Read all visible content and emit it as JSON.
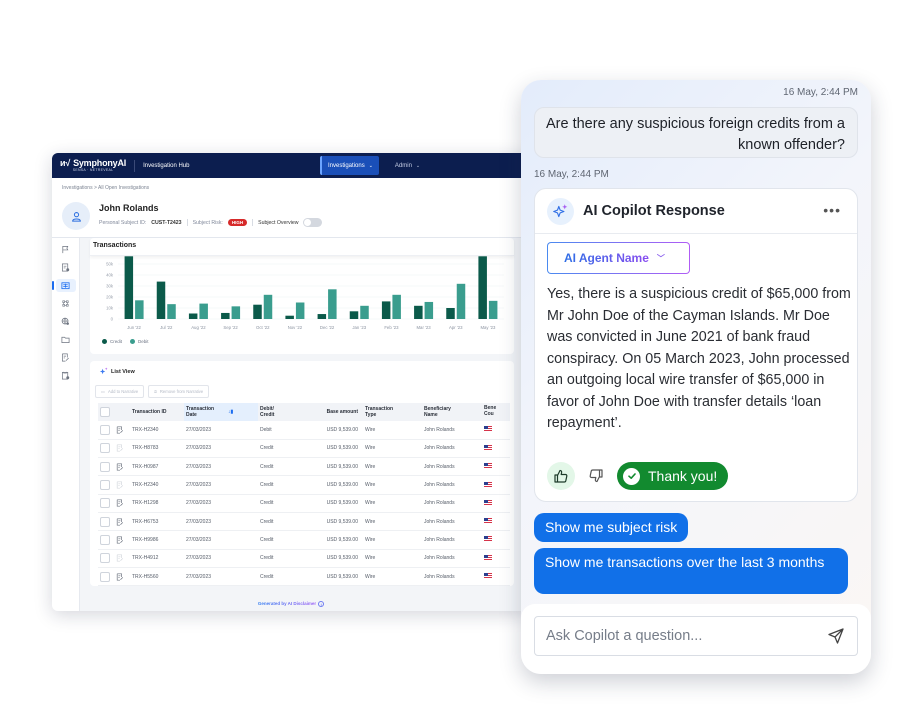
{
  "app": {
    "logo": "SymphonyAI",
    "logo_sub": "SENSA · NETREVEAL",
    "app_name": "Investigation Hub",
    "nav": [
      {
        "label": "Investigations",
        "active": true
      },
      {
        "label": "Admin",
        "active": false
      }
    ],
    "breadcrumb": "Investigations > All Open Investigations",
    "subject": {
      "name": "John Rolands",
      "id_label": "Personal Subject ID:",
      "id_value": "CUST-T2423",
      "risk_label": "Subject Risk:",
      "risk_value": "HIGH",
      "overview_label": "Subject Overview",
      "overview_on": false
    },
    "sidebar_icons": [
      "flag-icon",
      "report-icon",
      "transactions-icon",
      "network-icon",
      "globe-search-icon",
      "folder-icon",
      "notes-icon",
      "clipboard-icon"
    ],
    "sidebar_active_index": 2,
    "transactions_title": "Transactions",
    "list_view": {
      "title": "List View",
      "add_button": "Add to Narrative",
      "remove_button": "Remove from Narrative",
      "columns": [
        "Transaction ID",
        "Transaction Date",
        "Debit/ Credit",
        "Base amount",
        "Transaction Type",
        "Beneficiary Name",
        "Bene Cou"
      ],
      "rows": [
        {
          "id": "TRX-H2340",
          "date": "27/03/2023",
          "dc": "Debit",
          "amount": "USD 9,539.00",
          "type": "Wire",
          "beneficiary": "John Rolands",
          "country": "US",
          "note": true
        },
        {
          "id": "TRX-H8783",
          "date": "27/03/2023",
          "dc": "Credit",
          "amount": "USD 9,539.00",
          "type": "Wire",
          "beneficiary": "John Rolands",
          "country": "US",
          "note": false
        },
        {
          "id": "TRX-H0987",
          "date": "27/03/2023",
          "dc": "Credit",
          "amount": "USD 9,539.00",
          "type": "Wire",
          "beneficiary": "John Rolands",
          "country": "US",
          "note": true
        },
        {
          "id": "TRX-H2340",
          "date": "27/03/2023",
          "dc": "Credit",
          "amount": "USD 9,539.00",
          "type": "Wire",
          "beneficiary": "John Rolands",
          "country": "US",
          "note": false
        },
        {
          "id": "TRX-H1298",
          "date": "27/03/2023",
          "dc": "Credit",
          "amount": "USD 9,539.00",
          "type": "Wire",
          "beneficiary": "John Rolands",
          "country": "US",
          "note": true
        },
        {
          "id": "TRX-H6753",
          "date": "27/03/2023",
          "dc": "Credit",
          "amount": "USD 9,539.00",
          "type": "Wire",
          "beneficiary": "John Rolands",
          "country": "US",
          "note": true
        },
        {
          "id": "TRX-H9986",
          "date": "27/03/2023",
          "dc": "Credit",
          "amount": "USD 9,539.00",
          "type": "Wire",
          "beneficiary": "John Rolands",
          "country": "US",
          "note": true
        },
        {
          "id": "TRX-H4912",
          "date": "27/03/2023",
          "dc": "Credit",
          "amount": "USD 9,539.00",
          "type": "Wire",
          "beneficiary": "John Rolands",
          "country": "US",
          "note": false
        },
        {
          "id": "TRX-H5560",
          "date": "27/03/2023",
          "dc": "Credit",
          "amount": "USD 9,539.00",
          "type": "Wire",
          "beneficiary": "John Rolands",
          "country": "US",
          "note": true
        }
      ]
    },
    "disclaimer": "Generated by AI Disclaimer"
  },
  "chart_data": {
    "type": "bar",
    "title": "Transactions",
    "categories": [
      "Jun '22",
      "Jul '22",
      "Aug '22",
      "Sep '22",
      "Oct '22",
      "Nov '22",
      "Dec '22",
      "Jan '23",
      "Feb '23",
      "Mar '23",
      "Apr '23",
      "May '23"
    ],
    "series": [
      {
        "name": "Credit",
        "color": "#0b5a4a",
        "values": [
          57000,
          34000,
          5000,
          5500,
          13000,
          3000,
          4500,
          7000,
          16000,
          12000,
          10000,
          57000
        ]
      },
      {
        "name": "Debit",
        "color": "#3a9d8e",
        "values": [
          17000,
          13500,
          14000,
          11500,
          22000,
          15000,
          27000,
          12000,
          22000,
          15500,
          32000,
          16500
        ]
      }
    ],
    "yticks": [
      "0",
      "10k",
      "20k",
      "30k",
      "40k",
      "50k"
    ],
    "ylim": [
      0,
      55000
    ],
    "xlabel": "",
    "ylabel": "",
    "grid": true,
    "legend": "bottom-left"
  },
  "chat": {
    "user_timestamp": "16 May, 2:44 PM",
    "user_message": "Are there any suspicious foreign credits from a known offender?",
    "response_timestamp": "16 May, 2:44 PM",
    "response_title": "AI Copilot Response",
    "agent_name": "AI Agent Name",
    "response_text": "Yes, there is a suspicious credit of $65,000 from Mr John Doe of the Cayman Islands. Mr Doe was convicted in June 2021 of bank fraud conspiracy. On 05 March 2023, John processed an outgoing local wire transfer of $65,000 in favor of John Doe with transfer details ‘loan repayment’.",
    "feedback_label": "Thank you!",
    "suggestions": [
      "Show me subject risk",
      "Show me transactions over the last 3 months"
    ],
    "input_placeholder": "Ask Copilot a question...",
    "colors": {
      "accent": "#1170e8",
      "success": "#128a2f",
      "nav": "#0c1e4f",
      "risk": "#d62a2a"
    }
  }
}
